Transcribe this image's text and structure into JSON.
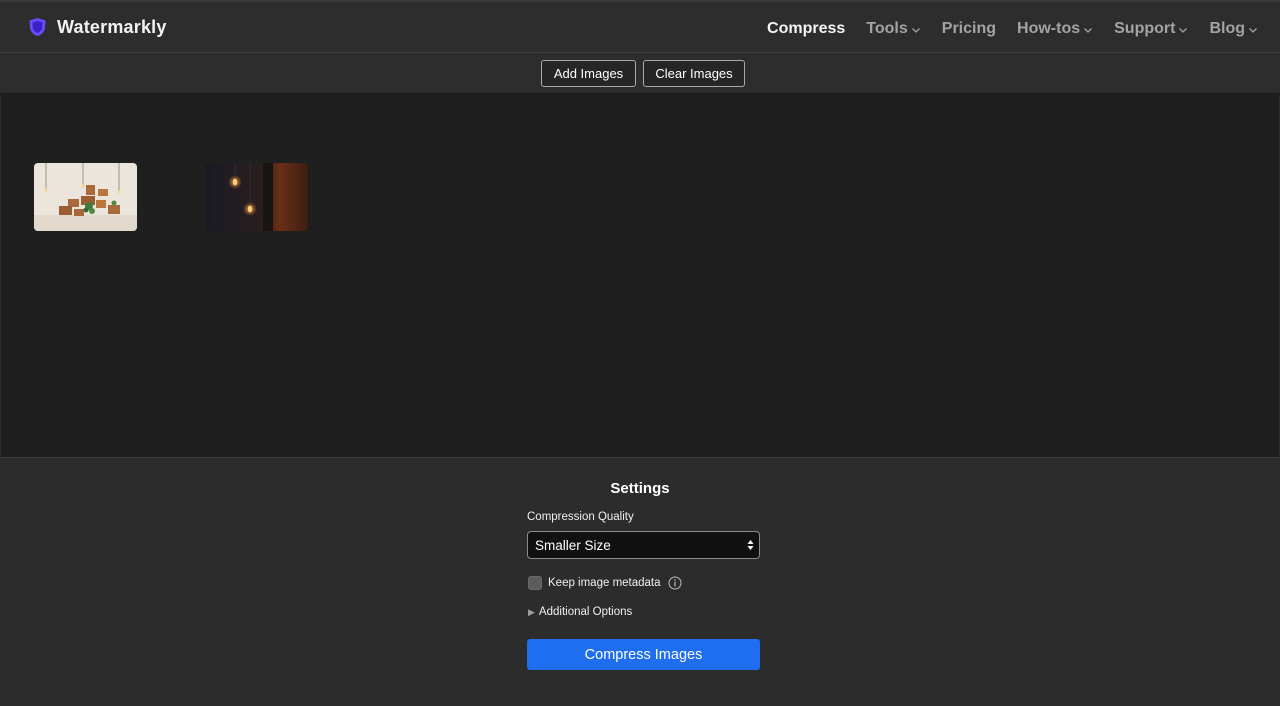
{
  "brand": {
    "name": "Watermarkly",
    "logo_icon": "shield-logo-icon",
    "accent": "#5b3df5"
  },
  "nav": {
    "items": [
      {
        "label": "Compress",
        "active": true,
        "dropdown": false
      },
      {
        "label": "Tools",
        "active": false,
        "dropdown": true
      },
      {
        "label": "Pricing",
        "active": false,
        "dropdown": false
      },
      {
        "label": "How-tos",
        "active": false,
        "dropdown": true
      },
      {
        "label": "Support",
        "active": false,
        "dropdown": true
      },
      {
        "label": "Blog",
        "active": false,
        "dropdown": true
      }
    ]
  },
  "toolbar": {
    "add_label": "Add Images",
    "clear_label": "Clear Images"
  },
  "images": [
    {
      "kind": "wall-shelves-with-plants"
    },
    {
      "kind": "dark-room-edison-bulbs"
    }
  ],
  "settings": {
    "title": "Settings",
    "quality_label": "Compression Quality",
    "quality_value": "Smaller Size",
    "metadata_label": "Keep image metadata",
    "metadata_checked": false,
    "additional_label": "Additional Options",
    "compress_label": "Compress Images",
    "primary_color": "#1f6ef0"
  }
}
